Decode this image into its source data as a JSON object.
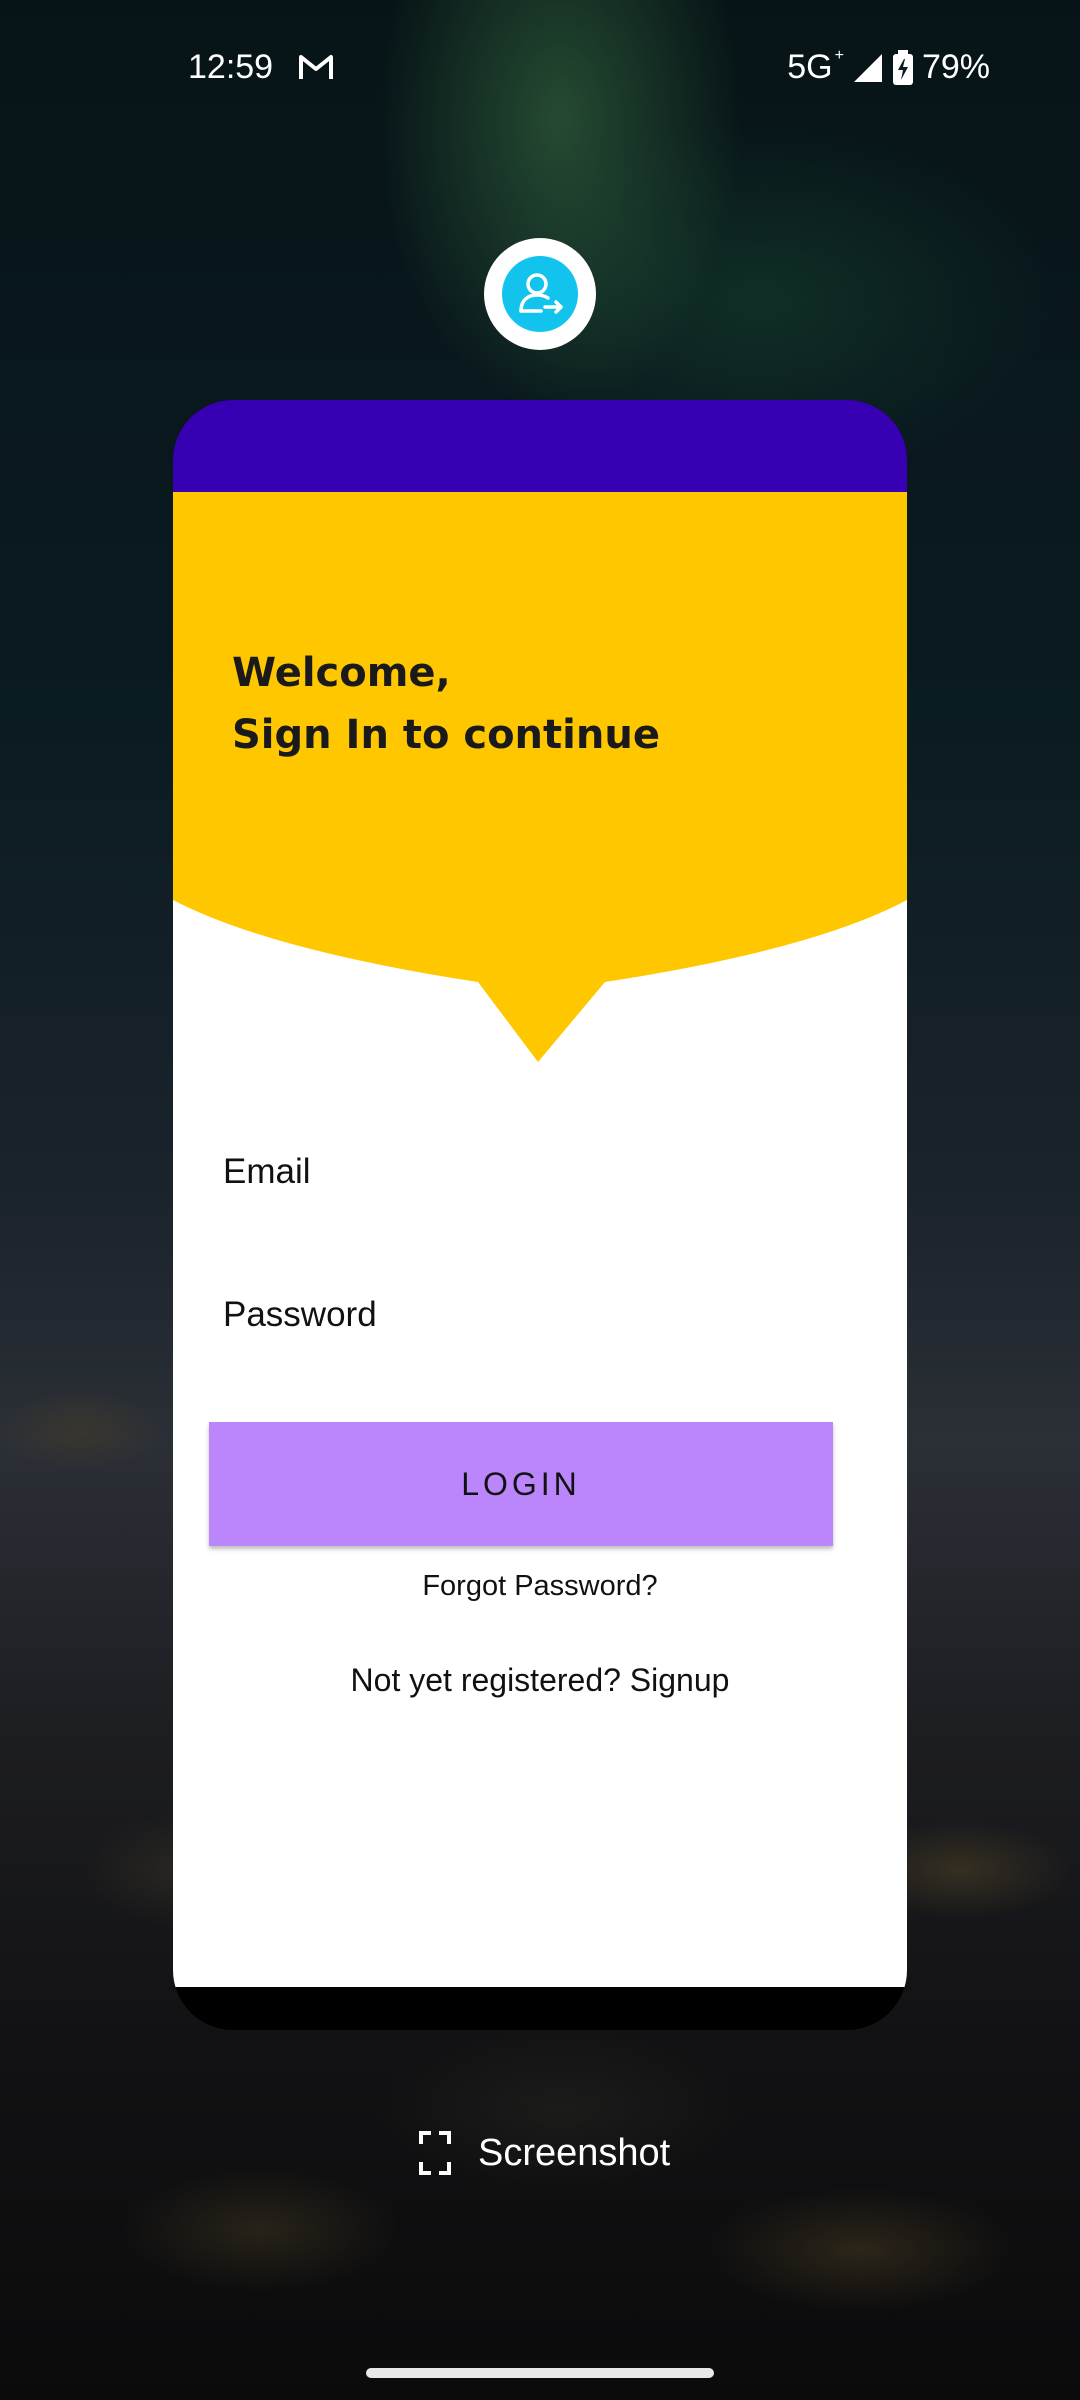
{
  "status_bar": {
    "time": "12:59",
    "network": "5G",
    "network_plus": "+",
    "battery_percent": "79%",
    "icons": [
      "gmail-icon",
      "signal-icon",
      "battery-charging-icon"
    ]
  },
  "avatar": {
    "icon": "user-switch-icon",
    "color": "#12c3ee"
  },
  "card": {
    "header_color": "#3700b3",
    "bubble_color": "#ffc700",
    "welcome_line1": "Welcome,",
    "welcome_line2": "Sign In to continue",
    "email_placeholder": "Email",
    "password_placeholder": "Password",
    "login_label": "LOGIN",
    "login_color": "#bb86fc",
    "forgot_password": "Forgot Password?",
    "signup_prompt": "Not yet registered? Signup"
  },
  "toast": {
    "label": "Screenshot",
    "icon": "screenshot-frame-icon"
  }
}
